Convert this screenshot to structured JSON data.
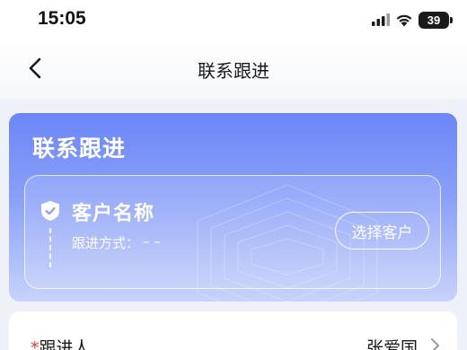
{
  "status_bar": {
    "time": "15:05",
    "battery": "39",
    "icons": [
      "signal-icon",
      "wifi-icon",
      "battery-icon"
    ]
  },
  "nav": {
    "title": "联系跟进",
    "back_icon": "chevron-left-icon"
  },
  "hero": {
    "title": "联系跟进",
    "customer_name": "客户名称",
    "follow_method_label": "跟进方式：",
    "follow_method_value": "– –",
    "select_button_label": "选择客户",
    "customer_icon": "shield-check-icon"
  },
  "form": {
    "rows": [
      {
        "required_mark": "*",
        "label": "跟进人",
        "value": "张爱国"
      }
    ],
    "row_icon": "chevron-right-icon"
  },
  "colors": {
    "hero_top": "#6b86f7",
    "hero_bottom": "#c8d3fb",
    "page_background": "#eef1f8",
    "required": "#e53935"
  }
}
